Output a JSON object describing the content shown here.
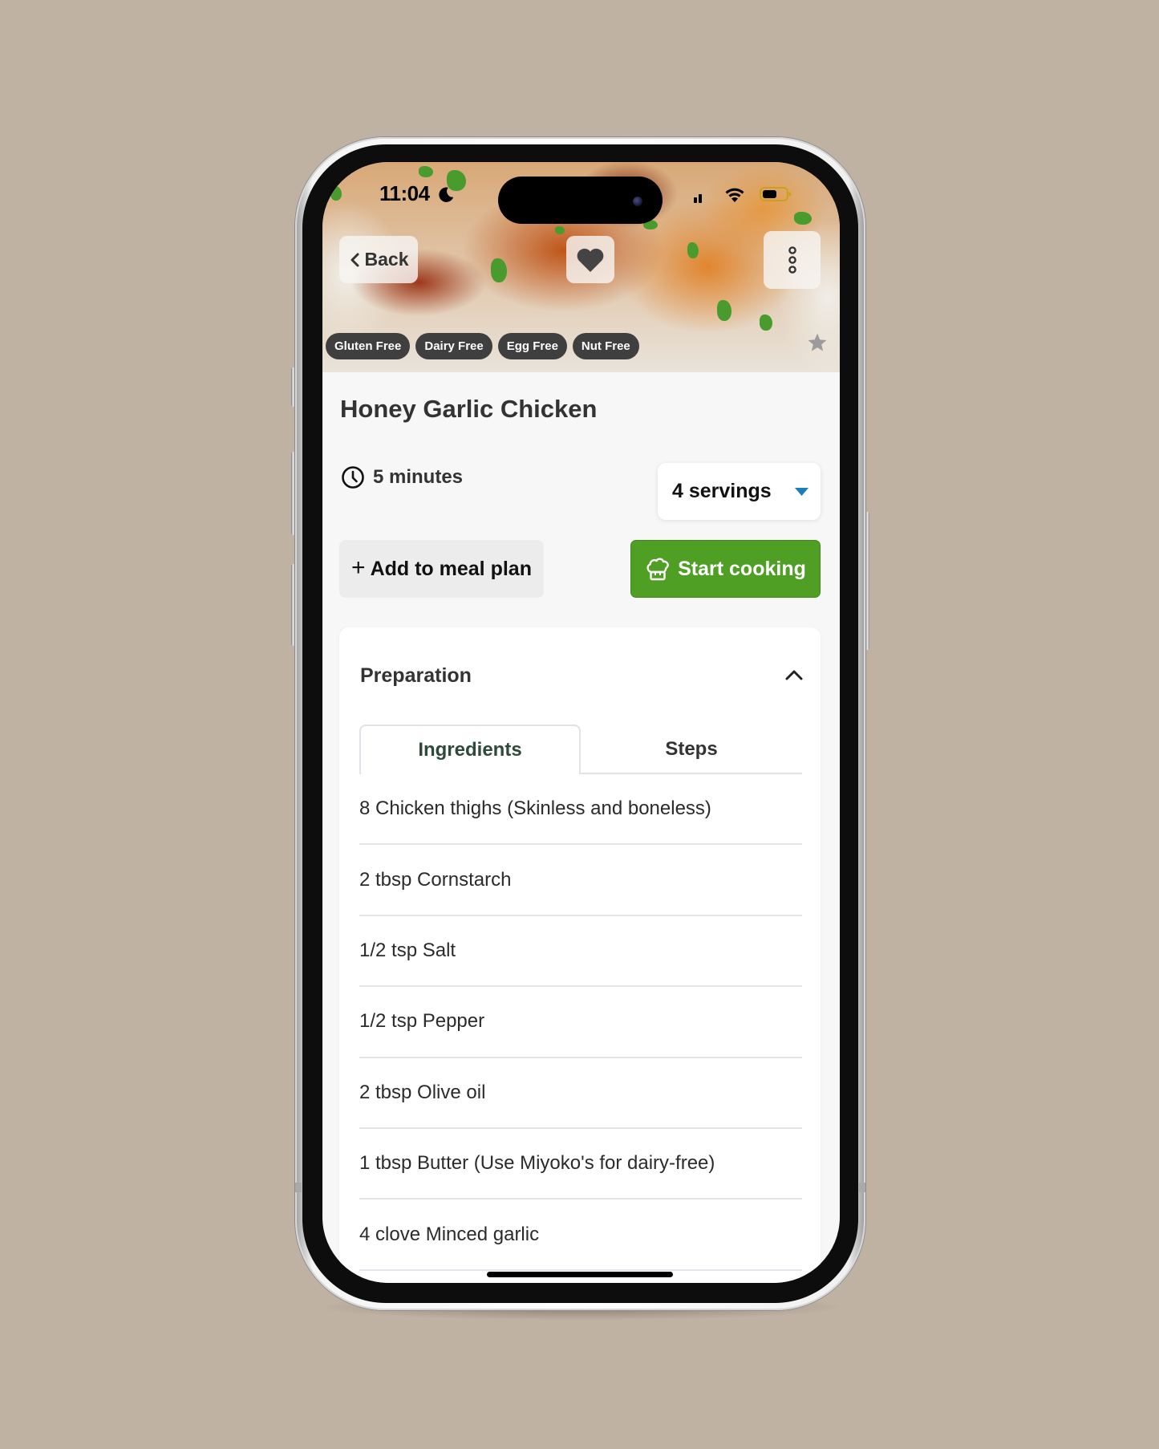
{
  "status_bar": {
    "time": "11:04",
    "focus_mode_icon": "moon-icon",
    "signal_icon": "cellular-signal-icon",
    "wifi_icon": "wifi-icon",
    "battery_icon": "battery-icon",
    "battery_level": 0.55,
    "low_power_mode": true
  },
  "header": {
    "back_label": "Back",
    "back_icon": "chevron-left-icon",
    "favorite_icon": "heart-icon",
    "more_icon": "more-vertical-icon",
    "rating_icon": "star-icon"
  },
  "tags": [
    "Gluten Free",
    "Dairy Free",
    "Egg Free",
    "Nut Free"
  ],
  "recipe": {
    "title": "Honey Garlic Chicken",
    "time_icon": "clock-icon",
    "time": "5 minutes",
    "servings": {
      "selected": "4 servings"
    }
  },
  "actions": {
    "add_to_meal_plan_icon": "+",
    "add_to_meal_plan": "Add to meal plan",
    "start_cooking_icon": "chef-hat-icon",
    "start_cooking": "Start cooking"
  },
  "preparation": {
    "title": "Preparation",
    "expanded": true,
    "tabs": [
      {
        "label": "Ingredients",
        "active": true
      },
      {
        "label": "Steps",
        "active": false
      }
    ],
    "ingredients": [
      "8 Chicken thighs (Skinless and boneless)",
      "2 tbsp Cornstarch",
      "1/2 tsp Salt",
      "1/2 tsp Pepper",
      "2 tbsp Olive oil",
      "1 tbsp Butter (Use Miyoko's for dairy-free)",
      "4 clove Minced garlic"
    ]
  },
  "colors": {
    "background": "#bfb2a3",
    "accent_green": "#4f9f24",
    "caret_blue": "#1a7fb8",
    "active_tab_text": "#2e4a3b",
    "chip_bg": "#3f3f3f"
  }
}
